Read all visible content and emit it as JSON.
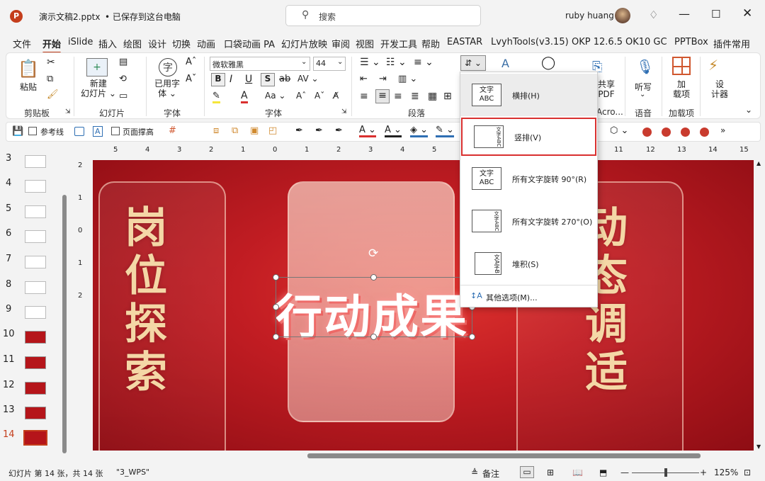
{
  "titlebar": {
    "filename": "演示文稿2.pptx",
    "save_status": "• 已保存到这台电脑",
    "search_placeholder": "搜索",
    "user_name": "ruby huang"
  },
  "tabs": [
    "文件",
    "开始",
    "iSlide",
    "插入",
    "绘图",
    "设计",
    "切换",
    "动画",
    "口袋动画 PA",
    "幻灯片放映",
    "审阅",
    "视图",
    "开发工具",
    "帮助",
    "EASTAR",
    "LvyhTools(v3.15)",
    "OKP 12.6.5",
    "OK10 GC",
    "PPTBox",
    "插件常用"
  ],
  "active_tab": "开始",
  "ribbon": {
    "paste": "粘贴",
    "clipboard_group": "剪贴板",
    "new_slide": "新建\n幻灯片",
    "slides_group": "幻灯片",
    "font_name": "微软雅黑",
    "font_size": "44",
    "used_fonts": "已用字\n体",
    "font_group_left": "字体",
    "font_group": "字体",
    "paragraph_group": "段落",
    "share_pdf": "共享\nPDF",
    "acro": "Acro...",
    "dictate": "听写",
    "voice_group": "语音",
    "addins": "加\n载项",
    "addins_group": "加载项",
    "designer": "设\n计器",
    "bold": "B",
    "italic": "I",
    "underline": "U",
    "shadow": "S",
    "char_icon": "字"
  },
  "qat": {
    "guides_label": "参考线",
    "page_fill": "页面撑高"
  },
  "ruler_top": [
    "5",
    "4",
    "3",
    "2",
    "1",
    "0",
    "1",
    "2",
    "3",
    "4",
    "5",
    "11",
    "12",
    "13",
    "14",
    "15"
  ],
  "ruler_left": [
    "2",
    "1",
    "0",
    "1",
    "2"
  ],
  "thumbnails": {
    "numbers": [
      "3",
      "4",
      "5",
      "6",
      "7",
      "8",
      "9",
      "10",
      "11",
      "12",
      "13",
      "14"
    ],
    "active": "14"
  },
  "slide": {
    "left_text": "岗位探索",
    "center_text": "行动成果",
    "right_text": "动态调适"
  },
  "dropdown": {
    "items": [
      {
        "icon_text": "文字\nABC",
        "label": "横排(H)"
      },
      {
        "icon_text": "文字ABC",
        "label": "竖排(V)"
      },
      {
        "icon_text": "文字\nABC",
        "label": "所有文字旋转 90°(R)"
      },
      {
        "icon_text": "文字ABC",
        "label": "所有文字旋转 270°(O)"
      },
      {
        "icon_text": "文A字B",
        "label": "堆积(S)"
      }
    ],
    "more_options": "其他选项(M)...",
    "highlight_color": "#d9302f"
  },
  "statusbar": {
    "slide_info": "幻灯片 第 14 张，共 14 张",
    "theme": "\"3_WPS\"",
    "notes": "备注",
    "zoom": "125%"
  },
  "colors": {
    "accent": "#c43e1c",
    "slide_red": "#c21d23",
    "gold_text": "#f4d7a6"
  }
}
